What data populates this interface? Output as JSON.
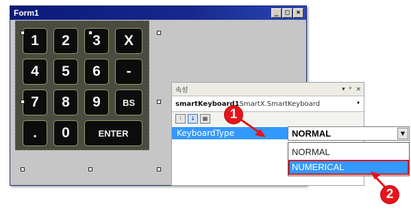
{
  "form": {
    "title": "Form1",
    "caption_buttons": {
      "minimize": "_",
      "maximize": "□",
      "close": "×"
    }
  },
  "keypad": {
    "keys": [
      {
        "label": "1"
      },
      {
        "label": "2"
      },
      {
        "label": "3"
      },
      {
        "label": "X"
      },
      {
        "label": "4"
      },
      {
        "label": "5"
      },
      {
        "label": "6"
      },
      {
        "label": "-"
      },
      {
        "label": "7"
      },
      {
        "label": "8"
      },
      {
        "label": "9"
      },
      {
        "label": "BS"
      },
      {
        "label": "."
      },
      {
        "label": "0"
      },
      {
        "label": "ENTER"
      }
    ]
  },
  "properties": {
    "title": "속성",
    "title_buttons": {
      "dropdown": "▾",
      "pin": "ᵖ",
      "close": "×"
    },
    "object_name": "smartKeyboard1",
    "object_type": " SmartX.SmartKeyboard",
    "toolbar_icons": [
      "categorized-icon",
      "alphabetical-icon",
      "property-pages-icon"
    ],
    "toolbar_glyphs": [
      "⁝",
      "↓",
      "▦"
    ],
    "selected_property": "KeyboardType",
    "value": "NORMAL",
    "options": [
      "NORMAL",
      "NUMERICAL"
    ],
    "highlighted_option": "NUMERICAL"
  },
  "annotations": {
    "step1": "1",
    "step2": "2"
  },
  "colors": {
    "accent": "#3399ff",
    "callout": "#e8131a",
    "titlebar": "#0b1a78"
  }
}
